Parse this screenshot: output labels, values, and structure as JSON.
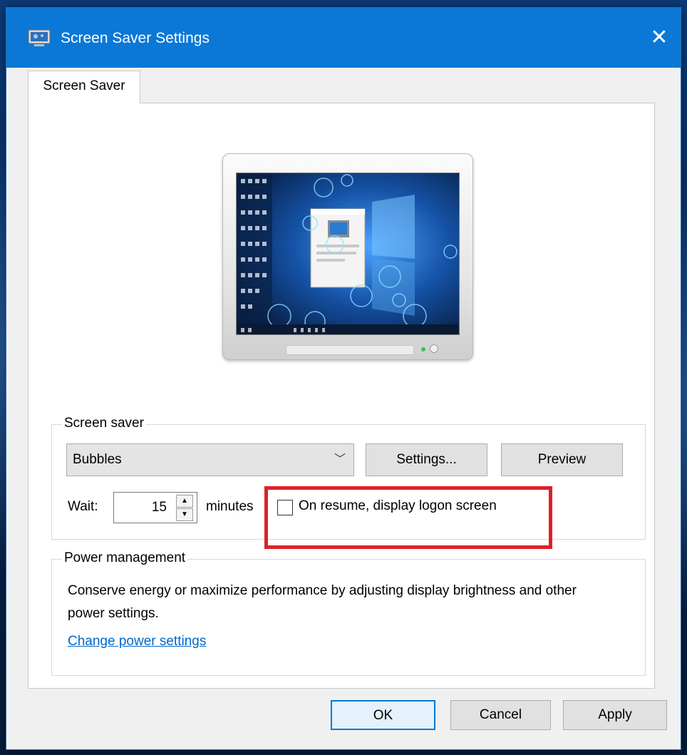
{
  "window": {
    "title": "Screen Saver Settings",
    "close_glyph": "✕"
  },
  "tabs": [
    {
      "label": "Screen Saver"
    }
  ],
  "screensaver_group": {
    "label": "Screen saver",
    "selected_saver": "Bubbles",
    "dropdown_glyph": "﹀",
    "settings_button": "Settings...",
    "preview_button": "Preview",
    "wait_label": "Wait:",
    "wait_value": "15",
    "minutes_label": "minutes",
    "logon_checkbox_label": "On resume, display logon screen",
    "logon_checked": false
  },
  "power_group": {
    "label": "Power management",
    "description": "Conserve energy or maximize performance by adjusting display brightness and other power settings.",
    "link": "Change power settings"
  },
  "buttons": {
    "ok": "OK",
    "cancel": "Cancel",
    "apply": "Apply"
  },
  "colors": {
    "titlebar": "#0b78d7",
    "highlight": "#e02027",
    "link": "#0066cc"
  },
  "icons": {
    "title_icon": "screen-saver-icon",
    "close_icon": "close-icon",
    "dropdown_icon": "chevron-down-icon",
    "spin_up": "spin-up-icon",
    "spin_down": "spin-down-icon"
  }
}
